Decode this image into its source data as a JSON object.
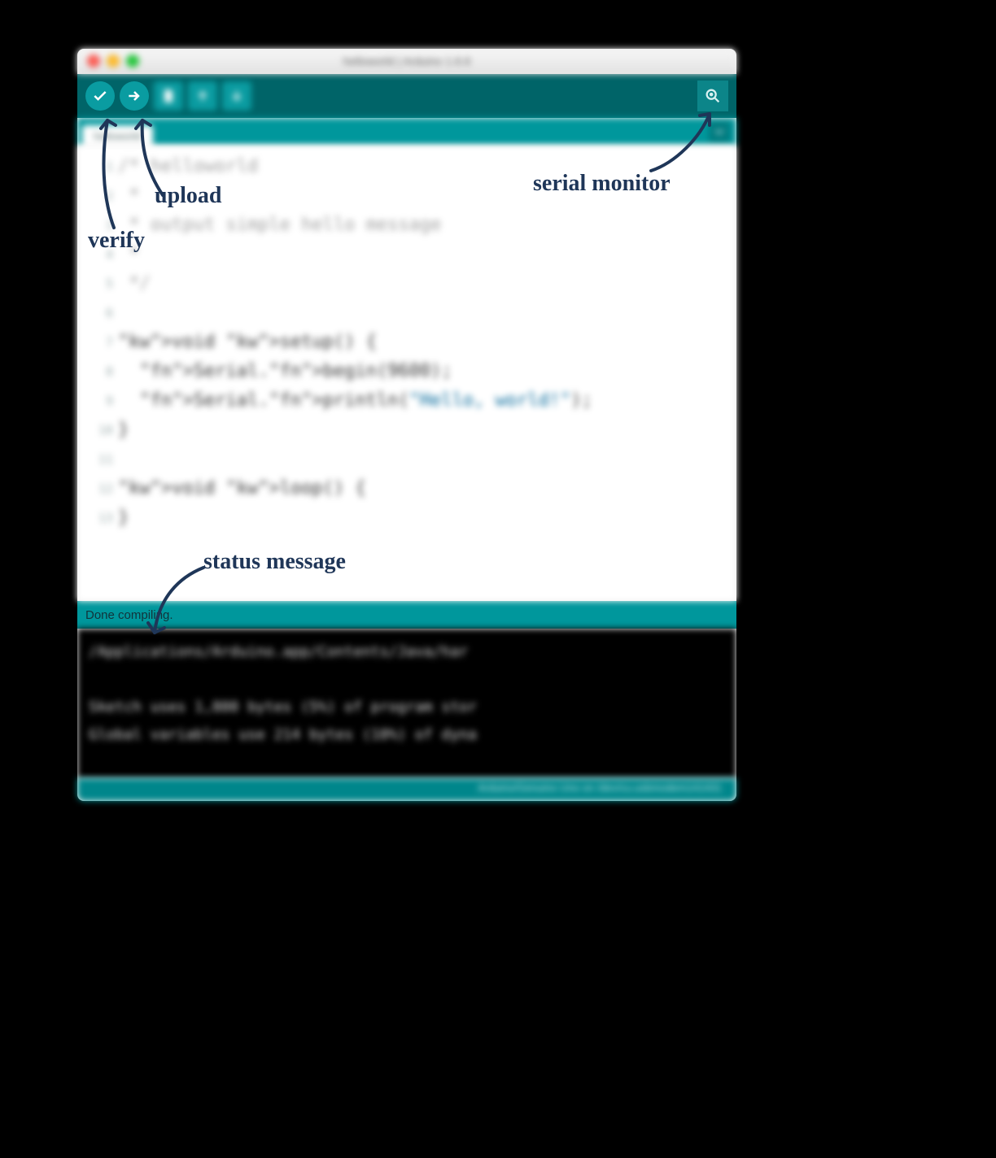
{
  "window": {
    "title": "helloworld | Arduino 1.6.6"
  },
  "tab": {
    "name": "helloworld"
  },
  "code": {
    "lines": [
      "/* helloworld",
      " *",
      " * output simple hello message",
      " *",
      " */",
      "",
      "void setup() {",
      "  Serial.begin(9600);",
      "  Serial.println(\"Hello, world!\");",
      "}",
      "",
      "void loop() {",
      "}"
    ],
    "gutter": [
      "1",
      "2",
      "3",
      "4",
      "5",
      "6",
      "7",
      "8",
      "9",
      "10",
      "11",
      "12",
      "13"
    ]
  },
  "status": {
    "message": "Done compiling."
  },
  "console": {
    "lines": [
      "/Applications/Arduino.app/Contents/Java/har",
      "",
      "Sketch uses 1,800 bytes (5%) of program stor",
      "Global variables use 214 bytes (10%) of dyna"
    ]
  },
  "bottom": {
    "board": "Arduino/Genuino Uno on /dev/cu.usbmodem141431"
  },
  "annotations": {
    "verify": "verify",
    "upload": "upload",
    "serial": "serial monitor",
    "status": "status message"
  }
}
